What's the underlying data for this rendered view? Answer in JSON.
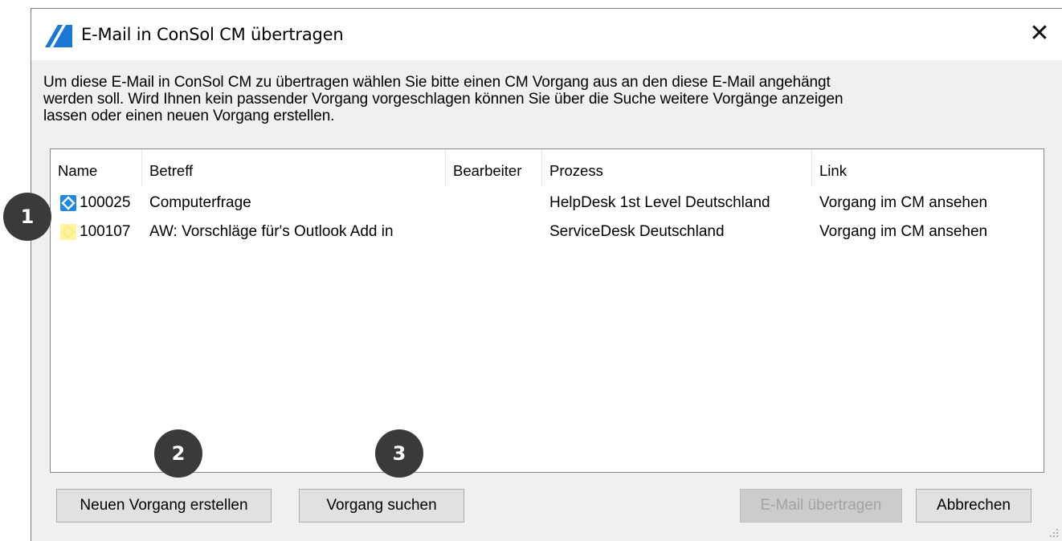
{
  "dialog": {
    "title": "E-Mail in ConSol CM übertragen",
    "close_glyph": "✕",
    "instructions": [
      "Um diese E-Mail in ConSol CM zu übertragen wählen Sie bitte einen CM Vorgang aus an den diese E-Mail angehängt",
      "werden soll. Wird Ihnen kein passender Vorgang vorgeschlagen können Sie über die Suche weitere Vorgänge anzeigen",
      "lassen oder einen neuen Vorgang erstellen."
    ]
  },
  "table": {
    "columns": [
      "Name",
      "Betreff",
      "Bearbeiter",
      "Prozess",
      "Link"
    ],
    "rows": [
      {
        "icon": "blue-diamond-icon",
        "name": "100025",
        "subject": "Computerfrage",
        "editor": "",
        "process": "HelpDesk 1st Level Deutschland",
        "link": "Vorgang im CM ansehen"
      },
      {
        "icon": "yellow-diamond-icon",
        "name": "100107",
        "subject": "AW: Vorschläge für's Outlook Add in",
        "editor": "",
        "process": "ServiceDesk Deutschland",
        "link": "Vorgang im CM ansehen"
      }
    ]
  },
  "buttons": {
    "new_case": "Neuen Vorgang erstellen",
    "search_case": "Vorgang suchen",
    "transfer": "E-Mail übertragen",
    "cancel": "Abbrechen"
  },
  "annotations": [
    "1",
    "2",
    "3"
  ],
  "colors": {
    "dialog_bg": "#f0f0f0",
    "badge": "#3a3a3a",
    "logo_blue": "#1a78d4",
    "icon_blue": "#1e88e5",
    "icon_yellow": "#fff59d"
  }
}
